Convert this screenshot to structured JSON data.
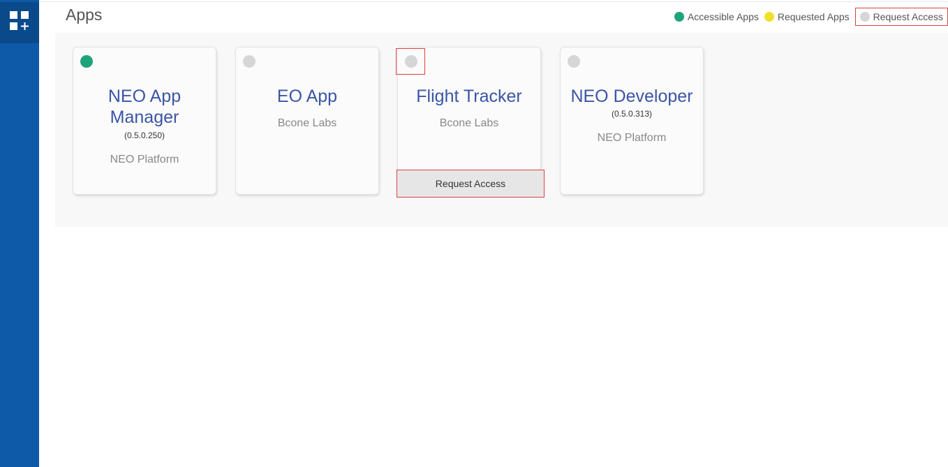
{
  "header": {
    "title": "Apps"
  },
  "legend": [
    {
      "label": "Accessible Apps",
      "color": "#1fa37a"
    },
    {
      "label": "Requested Apps",
      "color": "#f0e02a"
    },
    {
      "label": "Request Access",
      "color": "#d6d6d6"
    }
  ],
  "apps": [
    {
      "title": "NEO App Manager",
      "version": "(0.5.0.250)",
      "vendor": "NEO Platform",
      "status": "accessible",
      "status_color": "#1fa37a"
    },
    {
      "title": "EO App",
      "version": "",
      "vendor": "Bcone Labs",
      "status": "request-access",
      "status_color": "#d6d6d6"
    },
    {
      "title": "Flight Tracker",
      "version": "",
      "vendor": "Bcone Labs",
      "status": "request-access",
      "status_color": "#d6d6d6",
      "action_label": "Request Access"
    },
    {
      "title": "NEO Developer",
      "version": "(0.5.0.313)",
      "vendor": "NEO Platform",
      "status": "request-access",
      "status_color": "#d6d6d6"
    }
  ],
  "icons": {
    "app_logo": "apps-grid-plus-icon"
  },
  "colors": {
    "sidebar": "#0f5aa8",
    "accent_title": "#3a55a6"
  }
}
